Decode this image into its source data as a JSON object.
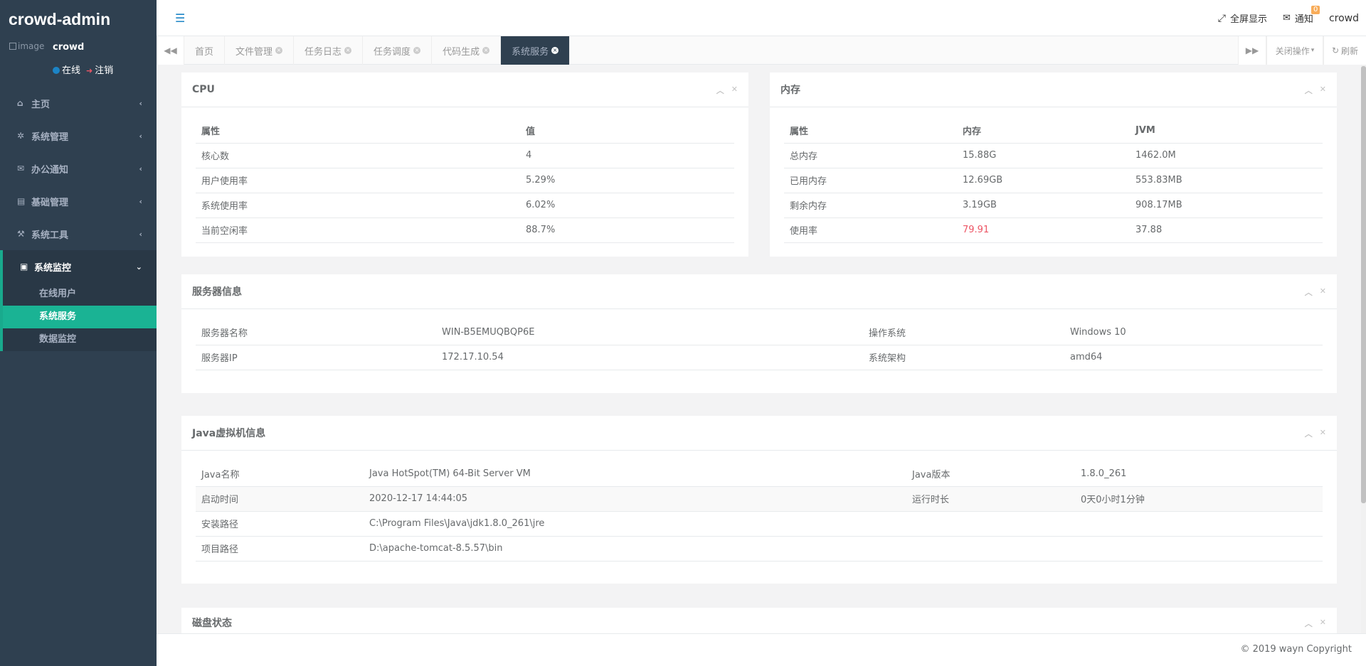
{
  "brand": "crowd-admin",
  "profile": {
    "image_alt": "image",
    "name": "crowd",
    "online_label": "在线",
    "logout_label": "注销"
  },
  "nav": [
    {
      "label": "主页",
      "icon": "home-icon"
    },
    {
      "label": "系统管理",
      "icon": "gear-icon"
    },
    {
      "label": "办公通知",
      "icon": "envelope-icon"
    },
    {
      "label": "基础管理",
      "icon": "id-card-icon"
    },
    {
      "label": "系统工具",
      "icon": "wrench-icon"
    },
    {
      "label": "系统监控",
      "icon": "monitor-icon"
    }
  ],
  "subnav": [
    "在线用户",
    "系统服务",
    "数据监控"
  ],
  "header": {
    "fullscreen_label": "全屏显示",
    "notify_label": "通知",
    "notify_count": "0",
    "user": "crowd"
  },
  "tabs": [
    "首页",
    "文件管理",
    "任务日志",
    "任务调度",
    "代码生成",
    "系统服务"
  ],
  "tabbar": {
    "close_ops_label": "关闭操作",
    "refresh_label": "刷新"
  },
  "cpu": {
    "title": "CPU",
    "headers": [
      "属性",
      "值"
    ],
    "rows": [
      [
        "核心数",
        "4"
      ],
      [
        "用户使用率",
        "5.29%"
      ],
      [
        "系统使用率",
        "6.02%"
      ],
      [
        "当前空闲率",
        "88.7%"
      ]
    ]
  },
  "memory": {
    "title": "内存",
    "headers": [
      "属性",
      "内存",
      "JVM"
    ],
    "rows": [
      [
        "总内存",
        "15.88G",
        "1462.0M"
      ],
      [
        "已用内存",
        "12.69GB",
        "553.83MB"
      ],
      [
        "剩余内存",
        "3.19GB",
        "908.17MB"
      ],
      [
        "使用率",
        "79.91",
        "37.88"
      ]
    ],
    "highlight_color": "#ed5565"
  },
  "server": {
    "title": "服务器信息",
    "rows": [
      [
        "服务器名称",
        "WIN-B5EMUQBQP6E",
        "操作系统",
        "Windows 10"
      ],
      [
        "服务器IP",
        "172.17.10.54",
        "系统架构",
        "amd64"
      ]
    ]
  },
  "jvm": {
    "title": "Java虚拟机信息",
    "rows": [
      [
        "Java名称",
        "Java HotSpot(TM) 64-Bit Server VM",
        "Java版本",
        "1.8.0_261"
      ],
      [
        "启动时间",
        "2020-12-17 14:44:05",
        "运行时长",
        "0天0小时1分钟"
      ],
      [
        "安装路径",
        "C:\\Program Files\\Java\\jdk1.8.0_261\\jre",
        "",
        ""
      ],
      [
        "项目路径",
        "D:\\apache-tomcat-8.5.57\\bin",
        "",
        ""
      ]
    ]
  },
  "disk": {
    "title": "磁盘状态"
  },
  "footer": "© 2019 wayn Copyright",
  "colors": {
    "sidebar": "#2f4050",
    "accent": "#1ab394",
    "link": "#1c84c6"
  }
}
